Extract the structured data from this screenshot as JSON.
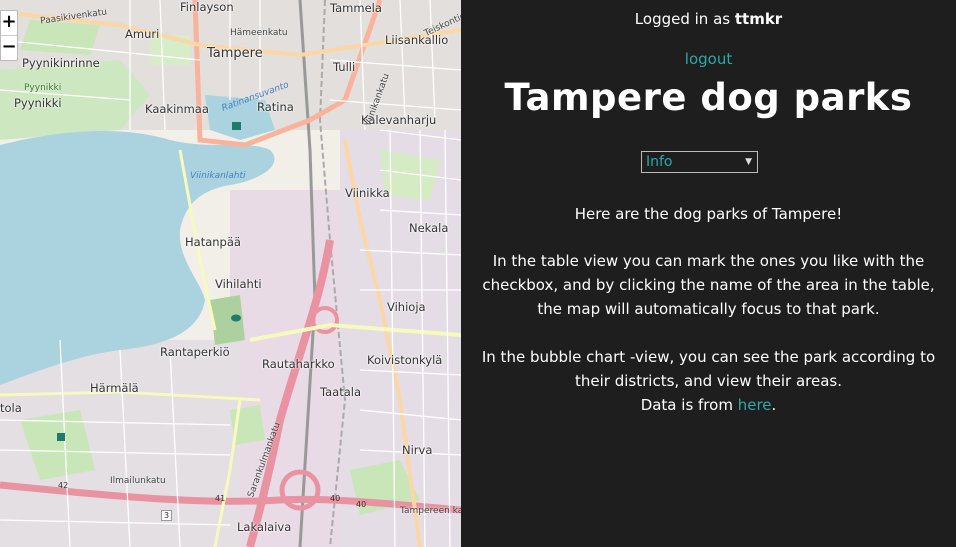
{
  "header": {
    "logged_in_prefix": "Logged in as",
    "username": "ttmkr",
    "logout_label": "logout",
    "title": "Tampere dog parks"
  },
  "view_select": {
    "selected": "Info"
  },
  "info": {
    "line1": "Here are the dog parks of Tampere!",
    "line2": "In the table view you can mark the ones you like with the checkbox, and by clicking the name of the area in the table, the map will automatically focus to that park.",
    "line3": "In the bubble chart -view, you can see the park according to their districts, and view their areas.",
    "data_prefix": "Data is from",
    "data_link": "here",
    "data_suffix": "."
  },
  "map": {
    "zoom_in": "+",
    "zoom_out": "−",
    "places": [
      "Finlayson",
      "Tammela",
      "Amuri",
      "Tampere",
      "Tulli",
      "Liisankallio",
      "Pyynikinrinne",
      "Pyynikki",
      "Pyynikki",
      "Kaakinmaa",
      "Ratina",
      "Kalevanharju",
      "Viinikka",
      "Nekala",
      "Hatanpää",
      "Vihilahti",
      "Vihioja",
      "Rantaperkiö",
      "Rautaharkko",
      "Koivistonkylä",
      "Härmälä",
      "Taatala",
      "Nirva",
      "tola",
      "Lakalaiva"
    ],
    "streets": [
      "Paasikivenkatu",
      "Teiskontie",
      "Ilmailunkatu",
      "Tampereen kaine",
      "Sarankulmankatu",
      "Viinikankatu",
      "Hämeenkatu"
    ],
    "water": [
      "Viinikanlahti",
      "Ratinansuvanto"
    ],
    "road_numbers": [
      "42",
      "41",
      "40",
      "3",
      "40"
    ],
    "colors": {
      "water": "#aad3df",
      "land": "#f2efe9",
      "green": "#c8e6b8",
      "motorway": "#e892a2",
      "trunk": "#f9b29c",
      "primary": "#fcd6a4",
      "secondary": "#f7fabf",
      "residential": "#e0dfdf",
      "panel_bg": "#1e1e1e",
      "accent": "#2aa9a9"
    }
  }
}
